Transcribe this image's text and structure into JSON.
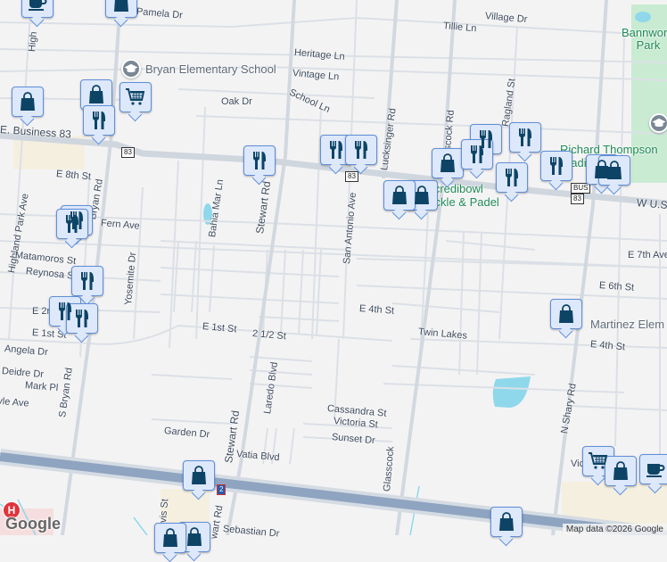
{
  "streets": {
    "pamela": "Pamela Dr",
    "heritage": "Heritage Ln",
    "vintage": "Vintage Ln",
    "school_ln": "School Ln",
    "oak": "Oak Dr",
    "tillie": "Tillie Ln",
    "village": "Village Dr",
    "business83": "E. Business 83",
    "e8th": "E 8th St",
    "bryan": "Bryan Rd",
    "highland_park": "Highland Park Ave",
    "high": "High",
    "fern": "Fern Ave",
    "matamoros": "Matamoros St",
    "reynosa": "Reynosa St",
    "yosemite": "Yosemite Dr",
    "bahia_mar": "Bahia Mar Ln",
    "stewart_n": "Stewart Rd",
    "san_antonio": "San Antonio Ave",
    "lucksinger": "Lucksinger Rd",
    "glasscock_n": "Glasscock Rd",
    "ragland": "Ragland St",
    "wus": "W U.S.",
    "e7th": "E 7th Ave",
    "e6th": "E 6th St",
    "e4th_w": "E 4th St",
    "e4th_e": "E 4th St",
    "twin_lakes": "Twin Lakes",
    "n_shary": "N Shary Rd",
    "e2nd": "E 2nd",
    "e1st_w": "E 1st St",
    "e1st": "E 1st St",
    "two_half": "2 1/2 St",
    "angela": "Angela Dr",
    "deidre": "Deidre Dr",
    "mark": "Mark Pl",
    "kyle": "Kyle Ave",
    "s_bryan": "S Bryan Rd",
    "laredo": "Laredo Blvd",
    "stewart_s": "Stewart Rd",
    "garden": "Garden Dr",
    "vatia": "Vatia Blvd",
    "cassandra": "Cassandra St",
    "victoria": "Victoria St",
    "sunset": "Sunset Dr",
    "glasscock_s": "Glasscock",
    "davis": "vis St",
    "stewart_b": "wart Rd",
    "sebastian": "Sebastian Dr",
    "vic": "Vic"
  },
  "places": {
    "bryan_school": "Bryan Elementary School",
    "bannworth": "Bannworth Park",
    "thompson": "Richard Thompson Stadium",
    "incredibowl": "Incredibowl Pickle & Padel",
    "martinez": "Martinez Elem"
  },
  "shields": {
    "bus83a": "83",
    "bus83b": "83",
    "bus83c": "83",
    "bus": "BUS",
    "i2": "2"
  },
  "markers": [
    "restaurant",
    "shopping",
    "restaurant",
    "shopping",
    "grocery",
    "cafe"
  ],
  "hospital": "H",
  "branding": {
    "logo": "Google",
    "attribution": "Map data ©2026 Google"
  },
  "colors": {
    "marker_fill": "#dde8fb",
    "marker_border": "#5f8fd9",
    "icon": "#0d4466",
    "highway": "#8ea4c0",
    "park": "#c9ebd2",
    "water": "#8fd8ec"
  }
}
